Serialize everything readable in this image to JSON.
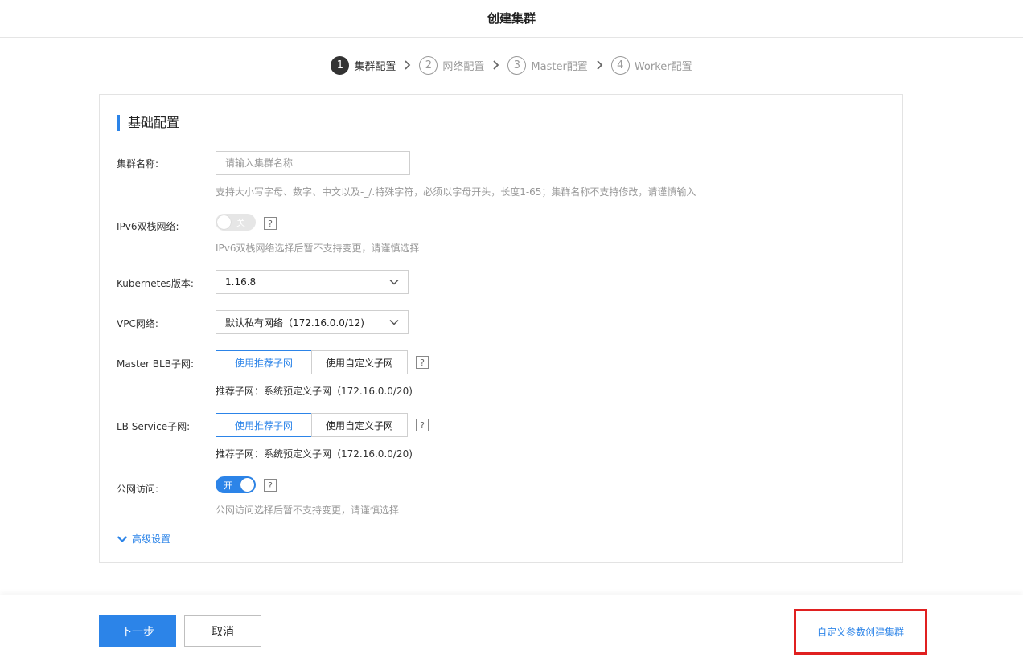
{
  "header": {
    "title": "创建集群"
  },
  "steps": [
    {
      "num": "1",
      "label": "集群配置"
    },
    {
      "num": "2",
      "label": "网络配置"
    },
    {
      "num": "3",
      "label": "Master配置"
    },
    {
      "num": "4",
      "label": "Worker配置"
    }
  ],
  "section": {
    "title": "基础配置"
  },
  "form": {
    "cluster_name": {
      "label": "集群名称:",
      "placeholder": "请输入集群名称",
      "value": "",
      "hint": "支持大小写字母、数字、中文以及-_/.特殊字符，必须以字母开头，长度1-65；集群名称不支持修改，请谨慎输入"
    },
    "ipv6": {
      "label": "IPv6双栈网络:",
      "toggle_text": "关",
      "help": "?",
      "hint": "IPv6双栈网络选择后暂不支持变更，请谨慎选择"
    },
    "k8s_version": {
      "label": "Kubernetes版本:",
      "value": "1.16.8"
    },
    "vpc": {
      "label": "VPC网络:",
      "value": "默认私有网络（172.16.0.0/12)"
    },
    "master_blb": {
      "label": "Master BLB子网:",
      "options": [
        "使用推荐子网",
        "使用自定义子网"
      ],
      "help": "?",
      "hint": "推荐子网：系统预定义子网（172.16.0.0/20)"
    },
    "lb_service": {
      "label": "LB Service子网:",
      "options": [
        "使用推荐子网",
        "使用自定义子网"
      ],
      "help": "?",
      "hint": "推荐子网：系统预定义子网（172.16.0.0/20)"
    },
    "public_access": {
      "label": "公网访问:",
      "toggle_text": "开",
      "help": "?",
      "hint": "公网访问选择后暂不支持变更，请谨慎选择"
    },
    "advanced": {
      "label": "高级设置"
    }
  },
  "footer": {
    "next": "下一步",
    "cancel": "取消",
    "custom_create": "自定义参数创建集群"
  },
  "colors": {
    "accent": "#2c84e8",
    "highlight_box": "#e02020"
  }
}
